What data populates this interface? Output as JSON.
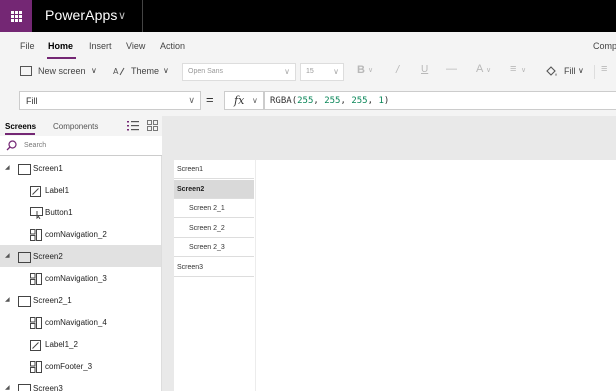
{
  "app": {
    "name": "PowerApps"
  },
  "menu": {
    "tabs": [
      "File",
      "Home",
      "Insert",
      "View",
      "Action",
      "Comp"
    ]
  },
  "ribbon": {
    "new_screen": "New screen",
    "theme": "Theme",
    "font": "Open Sans",
    "size": "15",
    "fill": "Fill"
  },
  "formula": {
    "property": "Fill",
    "equals": "=",
    "fx": "fx",
    "fn": "RGBA",
    "args": [
      "255",
      "255",
      "255",
      "1"
    ]
  },
  "panel": {
    "tabs": [
      "Screens",
      "Components"
    ],
    "search_placeholder": "Search",
    "tree": [
      {
        "label": "Screen1",
        "type": "screen",
        "level": 0,
        "expanded": true,
        "selected": false
      },
      {
        "label": "Label1",
        "type": "label",
        "level": 1,
        "selected": false
      },
      {
        "label": "Button1",
        "type": "button",
        "level": 1,
        "selected": false
      },
      {
        "label": "comNavigation_2",
        "type": "component",
        "level": 1,
        "selected": false
      },
      {
        "label": "Screen2",
        "type": "screen",
        "level": 0,
        "expanded": true,
        "selected": true
      },
      {
        "label": "comNavigation_3",
        "type": "component",
        "level": 1,
        "selected": false
      },
      {
        "label": "Screen2_1",
        "type": "screen",
        "level": 0,
        "expanded": true,
        "selected": false
      },
      {
        "label": "comNavigation_4",
        "type": "component",
        "level": 1,
        "selected": false
      },
      {
        "label": "Label1_2",
        "type": "label",
        "level": 1,
        "selected": false
      },
      {
        "label": "comFooter_3",
        "type": "component",
        "level": 1,
        "selected": false
      },
      {
        "label": "Screen3",
        "type": "screen",
        "level": 0,
        "expanded": true,
        "selected": false
      }
    ]
  },
  "canvas": {
    "nav_items": [
      {
        "label": "Screen1",
        "sub": false,
        "selected": false
      },
      {
        "label": "Screen2",
        "sub": false,
        "selected": true
      },
      {
        "label": "Screen 2_1",
        "sub": true,
        "selected": false
      },
      {
        "label": "Screen 2_2",
        "sub": true,
        "selected": false
      },
      {
        "label": "Screen 2_3",
        "sub": true,
        "selected": false
      },
      {
        "label": "Screen3",
        "sub": false,
        "selected": false
      }
    ]
  },
  "colors": {
    "brand": "#742774",
    "selected_row": "#e1e1e1"
  }
}
